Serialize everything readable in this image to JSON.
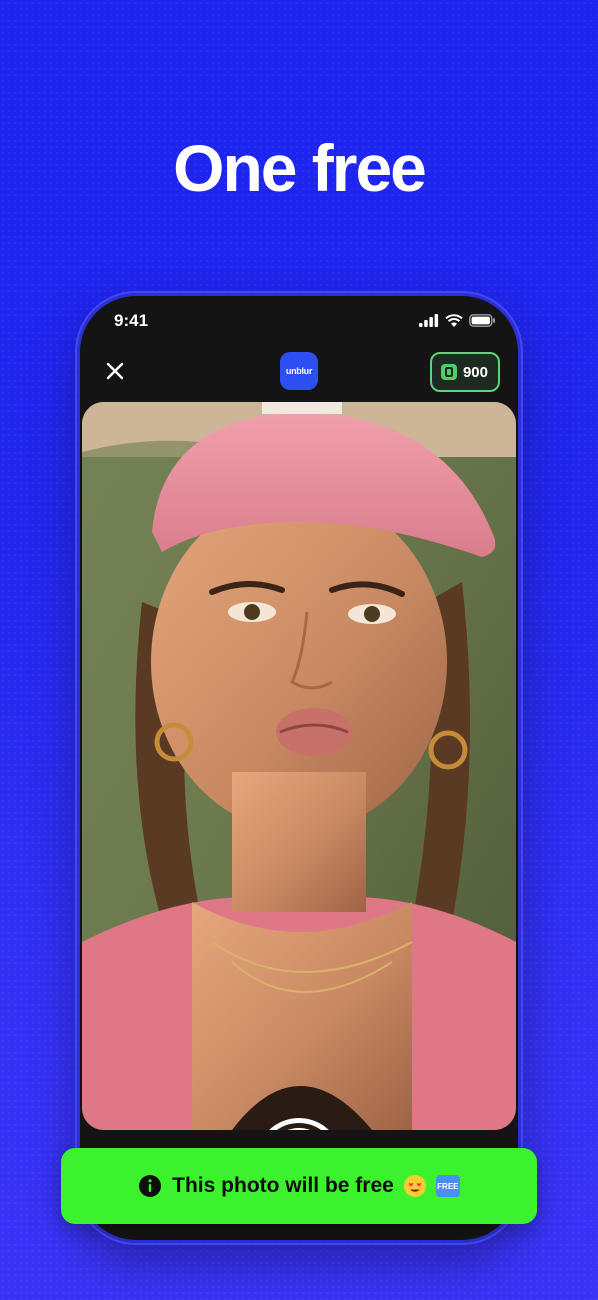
{
  "headline": "One free",
  "status_bar": {
    "time": "9:41",
    "icons": [
      "signal-icon",
      "wifi-icon",
      "battery-icon"
    ]
  },
  "top_bar": {
    "close_icon": "close-icon",
    "app_logo_text": "unblur",
    "credits_value": "900",
    "credits_icon": "coin-icon"
  },
  "camera_controls": {
    "flash_icon": "flash-off-icon",
    "shutter_icon": "shutter-button",
    "flip_icon": "flip-camera-icon"
  },
  "banner": {
    "info_icon": "info-icon",
    "text": "This photo will be free",
    "emoji_1": "heart-eyes-emoji",
    "free_tag": "FREE"
  },
  "colors": {
    "background": "#2226ee",
    "banner": "#3cf22c",
    "credits_border": "#5ed17a",
    "logo": "#2c4ef2"
  }
}
